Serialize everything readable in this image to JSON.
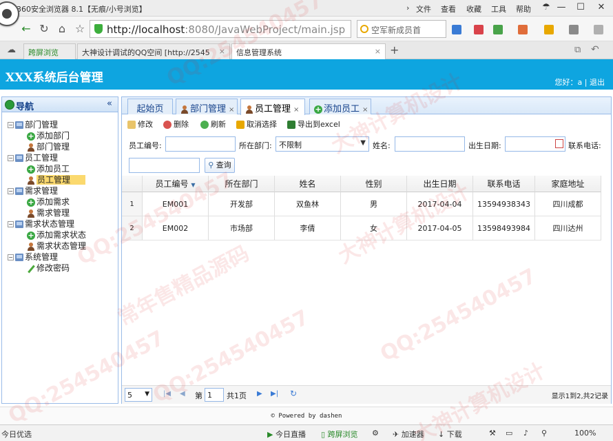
{
  "browser": {
    "window_title": "360安全浏览器 8.1【无痕/小号浏览】",
    "menu": [
      "文件",
      "查看",
      "收藏",
      "工具",
      "帮助"
    ],
    "address_host": "http://localhost",
    "address_rest": ":8080/JavaWebProject/main.jsp",
    "search_text": "空军新成员首",
    "tabs": [
      {
        "label": "跨屏浏览"
      },
      {
        "label": "大神设计调试的QQ空间 [http://2545"
      },
      {
        "label": "信息管理系统"
      }
    ]
  },
  "header": {
    "title": "XXX系统后台管理",
    "greeting": "您好：a",
    "logout": "退出"
  },
  "sidebar": {
    "title": "导航",
    "collapse": "«",
    "groups": [
      {
        "label": "部门管理",
        "items": [
          "添加部门",
          "部门管理"
        ]
      },
      {
        "label": "员工管理",
        "items": [
          "添加员工",
          "员工管理"
        ]
      },
      {
        "label": "需求管理",
        "items": [
          "添加需求",
          "需求管理"
        ]
      },
      {
        "label": "需求状态管理",
        "items": [
          "添加需求状态",
          "需求状态管理"
        ]
      },
      {
        "label": "系统管理",
        "items": [
          "修改密码"
        ]
      }
    ]
  },
  "content_tabs": [
    {
      "label": "起始页"
    },
    {
      "label": "部门管理"
    },
    {
      "label": "员工管理"
    },
    {
      "label": "添加员工"
    }
  ],
  "toolbar": {
    "edit": "修改",
    "delete": "删除",
    "refresh": "刷新",
    "cancel_select": "取消选择",
    "export": "导出到excel"
  },
  "filters": {
    "emp_no_label": "员工编号:",
    "dept_label": "所在部门:",
    "dept_value": "不限制",
    "name_label": "姓名:",
    "birth_label": "出生日期:",
    "phone_label": "联系电话:",
    "query": "查询"
  },
  "grid": {
    "columns": [
      "员工编号",
      "所在部门",
      "姓名",
      "性别",
      "出生日期",
      "联系电话",
      "家庭地址"
    ],
    "sort_indicator": "▼",
    "rows": [
      {
        "n": "1",
        "cells": [
          "EM001",
          "开发部",
          "双鱼林",
          "男",
          "2017-04-04",
          "13594938343",
          "四川成都"
        ]
      },
      {
        "n": "2",
        "cells": [
          "EM002",
          "市场部",
          "李倩",
          "女",
          "2017-04-05",
          "13598493984",
          "四川达州"
        ]
      }
    ]
  },
  "pager": {
    "page_size": "5",
    "page_prefix": "第",
    "page_value": "1",
    "page_suffix": "共1页",
    "info": "显示1到2,共2记录"
  },
  "footer": "© Powered by dashen",
  "statusbar": {
    "left": "今日优选",
    "live": "今日直播",
    "cross": "跨屏浏览",
    "speed": "加速器",
    "download": "下载",
    "zoom": "100%"
  },
  "watermarks": [
    "QQ:254540457",
    "大神计算机设计",
    "常年售精品源码"
  ],
  "colors": {
    "header": "#0ea5e0",
    "panel_border": "#99bbe8",
    "selected_node": "#fbd96e"
  }
}
